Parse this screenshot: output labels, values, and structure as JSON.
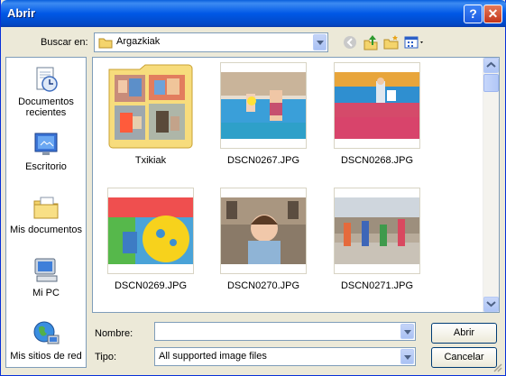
{
  "window": {
    "title": "Abrir",
    "help_glyph": "?",
    "close_glyph": "✕"
  },
  "lookin": {
    "label": "Buscar en:",
    "value": "Argazkiak"
  },
  "places": [
    {
      "label": "Documentos recientes",
      "icon": "recent-documents-icon"
    },
    {
      "label": "Escritorio",
      "icon": "desktop-icon"
    },
    {
      "label": "Mis documentos",
      "icon": "my-documents-icon"
    },
    {
      "label": "Mi PC",
      "icon": "my-computer-icon"
    },
    {
      "label": "Mis sitios de red",
      "icon": "network-places-icon"
    }
  ],
  "files": [
    {
      "name": "Txikiak",
      "type": "folder"
    },
    {
      "name": "DSCN0267.JPG",
      "type": "image"
    },
    {
      "name": "DSCN0268.JPG",
      "type": "image"
    },
    {
      "name": "DSCN0269.JPG",
      "type": "image"
    },
    {
      "name": "DSCN0270.JPG",
      "type": "image"
    },
    {
      "name": "DSCN0271.JPG",
      "type": "image"
    }
  ],
  "filename": {
    "label": "Nombre:",
    "value": ""
  },
  "filetype": {
    "label": "Tipo:",
    "value": "All supported image files"
  },
  "buttons": {
    "open": "Abrir",
    "cancel": "Cancelar"
  },
  "colors": {
    "title_bar": "#0058e6",
    "dialog_bg": "#ece9d8",
    "border": "#7f9db9"
  }
}
